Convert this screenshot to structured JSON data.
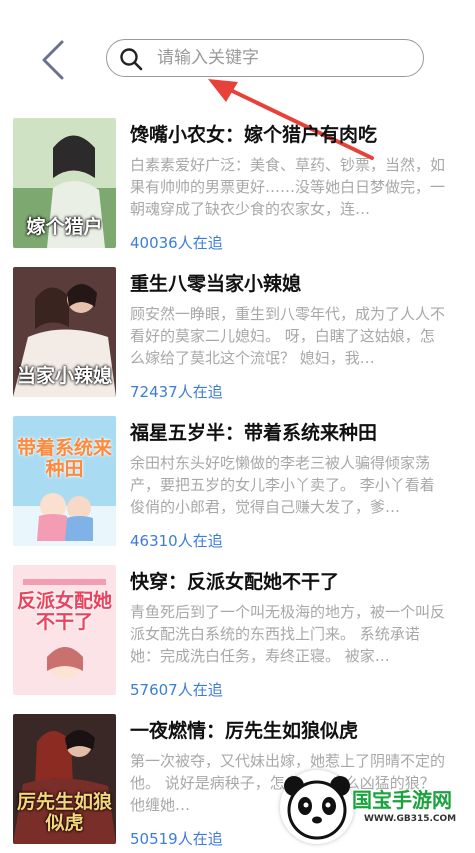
{
  "header": {
    "search_placeholder": "请输入关键字"
  },
  "books": [
    {
      "title": "馋嘴小农女：嫁个猎户有肉吃",
      "description": "白素素爱好广泛：美食、草药、钞票，当然，如果有帅帅的男票更好……没等她白日梦做完，一朝魂穿成了缺衣少食的农家女，连…",
      "readers": "40036人在追",
      "cover_text": "嫁个猎户",
      "cover_color": "#7da870"
    },
    {
      "title": "重生八零当家小辣媳",
      "description": "顾安然一睁眼，重生到八零年代，成为了人人不看好的莫家二儿媳妇。 呀，白瞎了这姑娘，怎么嫁给了莫北这个流氓？ 媳妇，我…",
      "readers": "72437人在追",
      "cover_text": "当家小辣媳",
      "cover_color": "#5a3d3a"
    },
    {
      "title": "福星五岁半：带着系统来种田",
      "description": "余田村东头好吃懒做的李老三被人骗得倾家荡产，要把五岁的女儿李小丫卖了。 李小丫看着俊俏的小郎君，觉得自己赚大发了，爹…",
      "readers": "46310人在追",
      "cover_text": "带着系统来种田",
      "cover_color": "#7cc6e8"
    },
    {
      "title": "快穿：反派女配她不干了",
      "description": "青鱼死后到了一个叫无极海的地方，被一个叫反派女配洗白系统的东西找上门来。 系统承诺她：完成洗白任务，寿终正寝。 被家…",
      "readers": "57607人在追",
      "cover_text": "反派女配她不干了",
      "cover_color": "#f6c8cf"
    },
    {
      "title": "一夜燃情：厉先生如狼似虎",
      "description": "第一次被夺，又代妹出嫁，她惹上了阴晴不定的他。 说好是病秧子，怎么会是这么凶猛的狼？ 他缠她…",
      "readers": "50519人在追",
      "cover_text": "厉先生如狼似虎",
      "cover_color": "#7a2e2a"
    }
  ],
  "watermark": {
    "brand": "国宝手游网",
    "url": "WWW.GB315.COM"
  },
  "colors": {
    "readers": "#3b7dd8",
    "annotation_arrow": "#e8413a"
  }
}
